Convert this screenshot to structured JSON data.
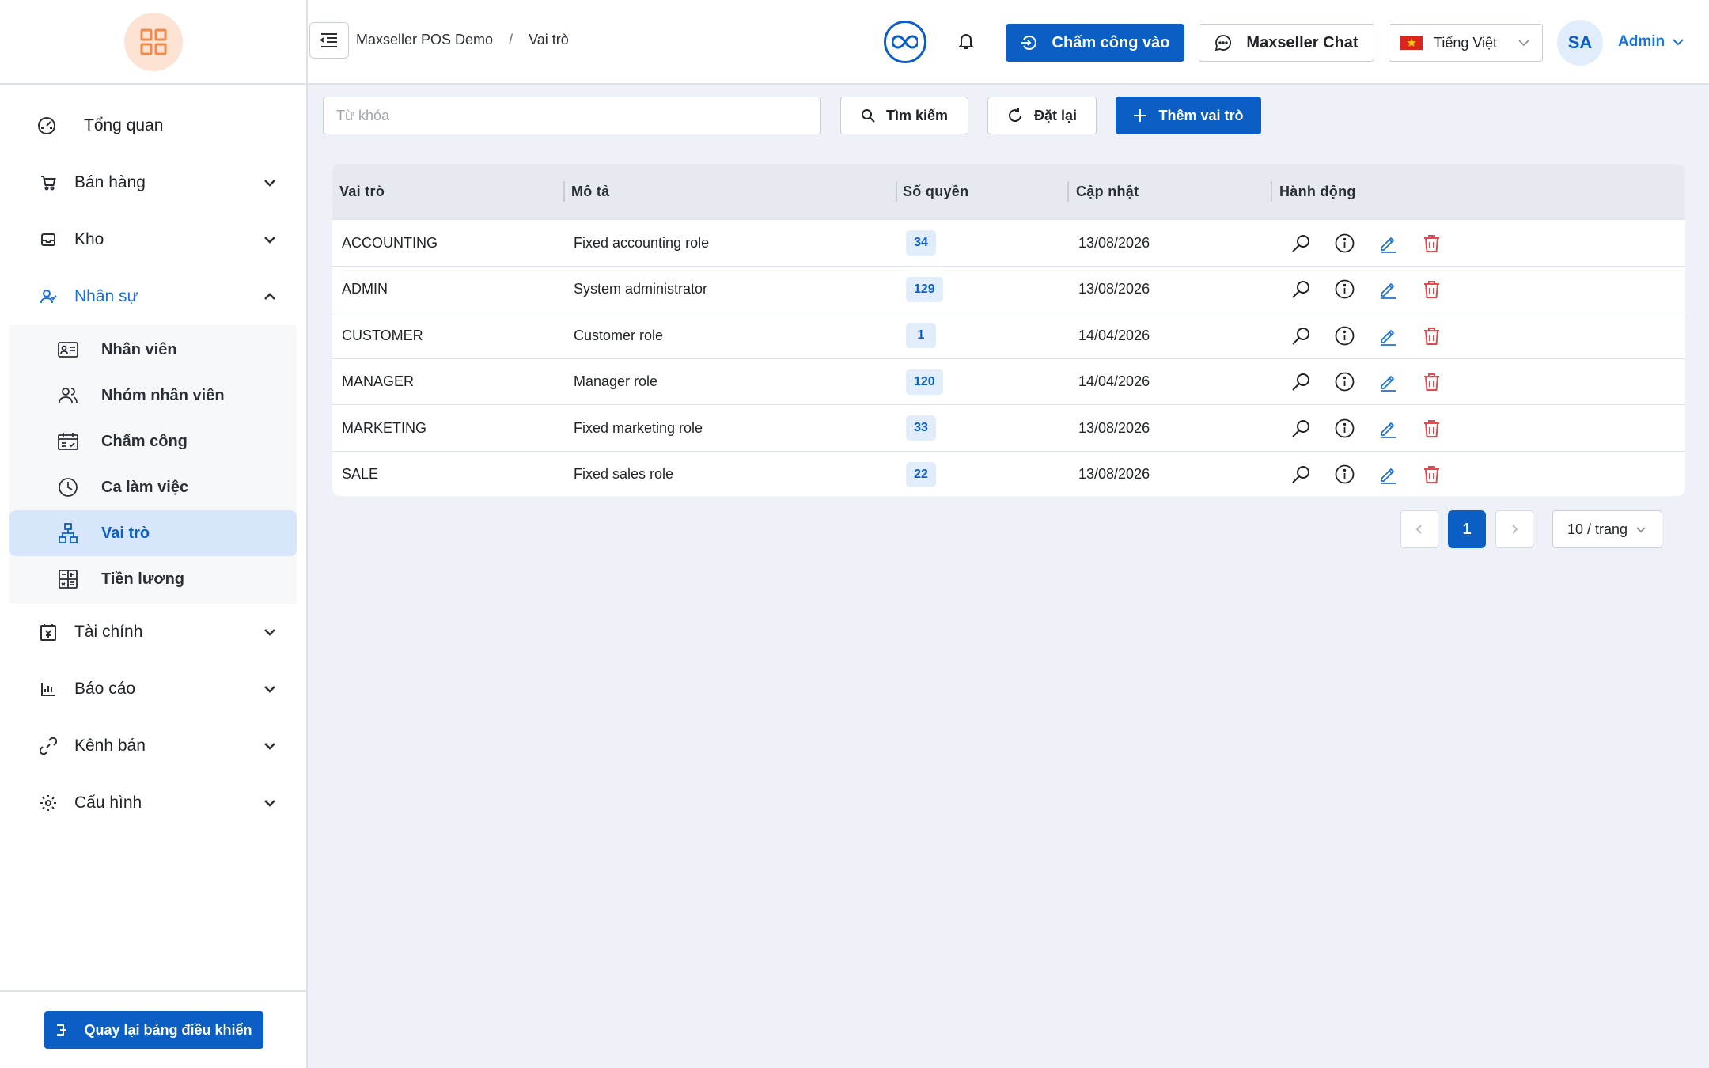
{
  "sidebar": {
    "menu": [
      {
        "label": "Tổng quan",
        "icon": "dashboard-gauge-icon"
      },
      {
        "label": "Bán hàng",
        "icon": "cart-icon"
      },
      {
        "label": "Kho",
        "icon": "inbox-icon"
      },
      {
        "label": "Nhân sự",
        "icon": "users-icon"
      },
      {
        "label": "Tài chính",
        "icon": "finance-icon"
      },
      {
        "label": "Báo cáo",
        "icon": "bar-chart-icon"
      },
      {
        "label": "Kênh bán",
        "icon": "link-icon"
      },
      {
        "label": "Cấu hình",
        "icon": "gear-icon"
      }
    ],
    "submenu": [
      {
        "label": "Nhân viên",
        "icon": "id-card-icon"
      },
      {
        "label": "Nhóm nhân viên",
        "icon": "user-group-icon"
      },
      {
        "label": "Chấm công",
        "icon": "calendar-check-icon"
      },
      {
        "label": "Ca làm việc",
        "icon": "clock-icon"
      },
      {
        "label": "Vai trò",
        "icon": "org-chart-icon"
      },
      {
        "label": "Tiền lương",
        "icon": "calculator-icon"
      }
    ],
    "back_button": "Quay lại bảng điều khiển"
  },
  "header": {
    "breadcrumb": [
      "Maxseller POS Demo",
      "Vai trò"
    ],
    "checkin_button": "Chấm công vào",
    "chat_button": "Maxseller Chat",
    "language": "Tiếng Việt",
    "avatar_initials": "SA",
    "user_name": "Admin"
  },
  "toolbar": {
    "search_placeholder": "Từ khóa",
    "search_button": "Tìm kiếm",
    "reset_button": "Đặt lại",
    "add_button": "Thêm vai trò"
  },
  "table": {
    "columns": [
      "Vai trò",
      "Mô tả",
      "Số quyền",
      "Cập nhật",
      "Hành động"
    ],
    "rows": [
      {
        "role": "ACCOUNTING",
        "desc": "Fixed accounting role",
        "perms": "34",
        "updated": "13/08/2026"
      },
      {
        "role": "ADMIN",
        "desc": "System administrator",
        "perms": "129",
        "updated": "13/08/2026"
      },
      {
        "role": "CUSTOMER",
        "desc": "Customer role",
        "perms": "1",
        "updated": "14/04/2026"
      },
      {
        "role": "MANAGER",
        "desc": "Manager role",
        "perms": "120",
        "updated": "14/04/2026"
      },
      {
        "role": "MARKETING",
        "desc": "Fixed marketing role",
        "perms": "33",
        "updated": "13/08/2026"
      },
      {
        "role": "SALE",
        "desc": "Fixed sales role",
        "perms": "22",
        "updated": "13/08/2026"
      }
    ]
  },
  "pagination": {
    "current_page": "1",
    "page_size": "10 / trang"
  },
  "colors": {
    "primary": "#0b5fc4",
    "accent_text": "#1a73d9",
    "logo_bg": "#fde3d4",
    "logo_fg": "#f08a4b",
    "delete": "#e5484d"
  }
}
